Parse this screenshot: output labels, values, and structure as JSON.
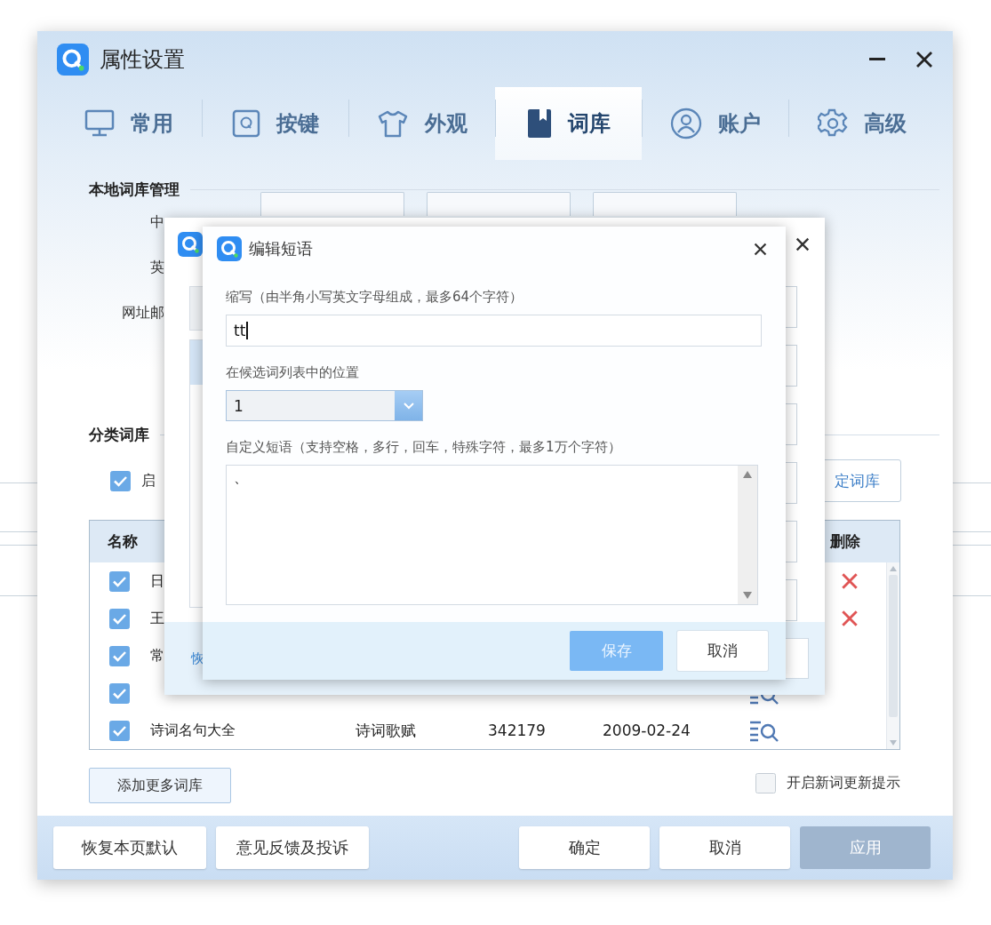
{
  "window": {
    "title": "属性设置"
  },
  "tabs": [
    {
      "label": "常用",
      "selected": false
    },
    {
      "label": "按键",
      "selected": false
    },
    {
      "label": "外观",
      "selected": false
    },
    {
      "label": "词库",
      "selected": true
    },
    {
      "label": "账户",
      "selected": false
    },
    {
      "label": "高级",
      "selected": false
    }
  ],
  "local_library": {
    "heading": "本地词库管理",
    "rows": [
      {
        "label": "中"
      },
      {
        "label": "英"
      },
      {
        "label": "网址邮"
      }
    ]
  },
  "category_library": {
    "heading": "分类词库",
    "enable": {
      "label": "启",
      "checked": true
    },
    "button": "定词库",
    "table": {
      "columns": [
        "名称",
        "删除"
      ],
      "rows": [
        {
          "name": "日",
          "checked": true,
          "kind": "delete"
        },
        {
          "name": "王",
          "checked": true,
          "kind": "delete"
        },
        {
          "name": "常",
          "checked": true
        },
        {
          "checked": true,
          "kind": "view"
        },
        {
          "name": "诗词名句大全",
          "category": "诗词歌赋",
          "count": "342179",
          "date": "2009-02-24",
          "checked": true,
          "kind": "view"
        }
      ]
    }
  },
  "add_button": "添加更多词库",
  "update_hint": {
    "label": "开启新词更新提示",
    "checked": false
  },
  "footer": {
    "buttons": [
      {
        "label": "恢复本页默认",
        "disabled": false
      },
      {
        "label": "意见反馈及投诉",
        "disabled": false
      },
      {
        "label": "确定",
        "disabled": false
      },
      {
        "label": "取消",
        "disabled": false
      },
      {
        "label": "应用",
        "disabled": true
      }
    ]
  },
  "back_dialog": {
    "link": "恢"
  },
  "edit_dialog": {
    "title": "编辑短语",
    "abbr_label": "缩写（由半角小写英文字母组成，最多64个字符）",
    "abbr_value": "tt",
    "position_label": "在候选词列表中的位置",
    "position_value": "1",
    "phrase_label": "自定义短语（支持空格，多行，回车，特殊字符，最多1万个字符）",
    "phrase_value": "、",
    "buttons": [
      {
        "label": "保存",
        "kind": "primary"
      },
      {
        "label": "取消",
        "kind": "default"
      }
    ]
  }
}
